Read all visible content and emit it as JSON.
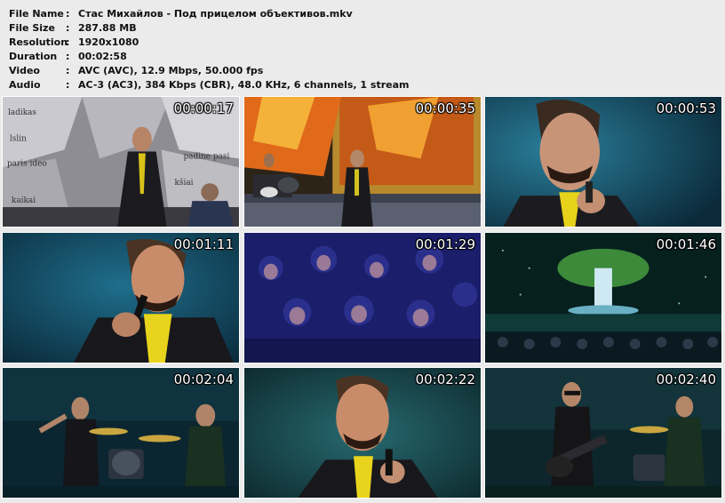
{
  "info": [
    {
      "label": "File Name",
      "value": "Стас Михайлов - Под прицелом объективов.mkv"
    },
    {
      "label": "File Size",
      "value": "287.88 MB"
    },
    {
      "label": "Resolution",
      "value": "1920x1080"
    },
    {
      "label": "Duration",
      "value": "00:02:58"
    },
    {
      "label": "Video",
      "value": "AVC (AVC), 12.9 Mbps, 50.000 fps"
    },
    {
      "label": "Audio",
      "value": "AC-3 (AC3), 384 Kbps (CBR), 48.0 KHz, 6 channels, 1 stream"
    }
  ],
  "separator": ":",
  "thumbnails": [
    {
      "time": "00:00:17",
      "scene": "singer-newspaper-backdrop"
    },
    {
      "time": "00:00:35",
      "scene": "stage-golden-frame"
    },
    {
      "time": "00:00:53",
      "scene": "closeup-singer-mic"
    },
    {
      "time": "00:01:11",
      "scene": "closeup-singer-yellow-tie"
    },
    {
      "time": "00:01:29",
      "scene": "audience-blue"
    },
    {
      "time": "00:01:46",
      "scene": "stage-waterfall-wide"
    },
    {
      "time": "00:02:04",
      "scene": "band-drummer-guitarist"
    },
    {
      "time": "00:02:22",
      "scene": "closeup-singer-smiling"
    },
    {
      "time": "00:02:40",
      "scene": "guitarist-and-drummer"
    }
  ]
}
